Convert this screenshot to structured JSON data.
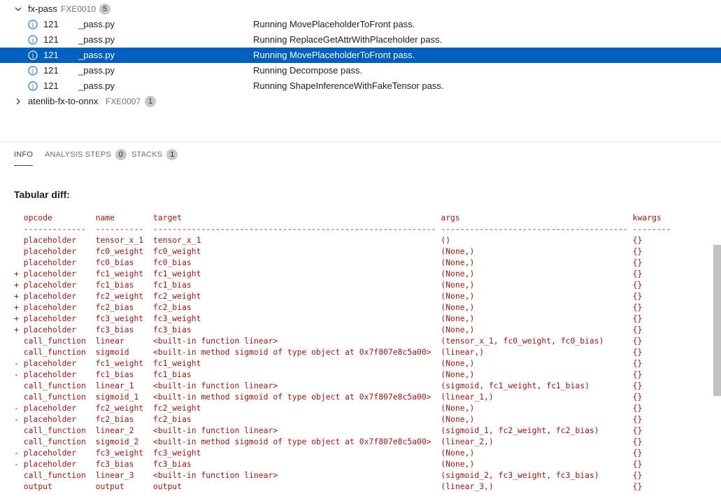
{
  "rules": [
    {
      "name": "fx-pass",
      "id": "FXE0010",
      "count": "5",
      "expanded": true
    },
    {
      "name": "atenlib-fx-to-onnx",
      "id": "FXE0007",
      "count": "1",
      "expanded": false
    }
  ],
  "results": [
    {
      "line": "121",
      "file": "_pass.py",
      "message": "Running MovePlaceholderToFront pass.",
      "selected": false
    },
    {
      "line": "121",
      "file": "_pass.py",
      "message": "Running ReplaceGetAttrWithPlaceholder pass.",
      "selected": false
    },
    {
      "line": "121",
      "file": "_pass.py",
      "message": "Running MovePlaceholderToFront pass.",
      "selected": true
    },
    {
      "line": "121",
      "file": "_pass.py",
      "message": "Running Decompose pass.",
      "selected": false
    },
    {
      "line": "121",
      "file": "_pass.py",
      "message": "Running ShapeInferenceWithFakeTensor pass.",
      "selected": false
    }
  ],
  "tabs": [
    {
      "label": "INFO",
      "count": ""
    },
    {
      "label": "ANALYSIS STEPS",
      "count": "0"
    },
    {
      "label": "STACKS",
      "count": "1"
    }
  ],
  "active_tab": "INFO",
  "heading": "Tabular diff:",
  "diff_header": [
    "opcode",
    "name",
    "target",
    "args",
    "kwargs"
  ],
  "diff_separator": [
    "-------------",
    "----------",
    "-----------------------------------------------------------",
    "---------------------------------------",
    "--------"
  ],
  "diff_rows": [
    [
      " ",
      "placeholder",
      "tensor_x_1",
      "tensor_x_1",
      "()",
      "{}"
    ],
    [
      " ",
      "placeholder",
      "fc0_weight",
      "fc0_weight",
      "(None,)",
      "{}"
    ],
    [
      " ",
      "placeholder",
      "fc0_bias",
      "fc0_bias",
      "(None,)",
      "{}"
    ],
    [
      "+",
      "placeholder",
      "fc1_weight",
      "fc1_weight",
      "(None,)",
      "{}"
    ],
    [
      "+",
      "placeholder",
      "fc1_bias",
      "fc1_bias",
      "(None,)",
      "{}"
    ],
    [
      "+",
      "placeholder",
      "fc2_weight",
      "fc2_weight",
      "(None,)",
      "{}"
    ],
    [
      "+",
      "placeholder",
      "fc2_bias",
      "fc2_bias",
      "(None,)",
      "{}"
    ],
    [
      "+",
      "placeholder",
      "fc3_weight",
      "fc3_weight",
      "(None,)",
      "{}"
    ],
    [
      "+",
      "placeholder",
      "fc3_bias",
      "fc3_bias",
      "(None,)",
      "{}"
    ],
    [
      " ",
      "call_function",
      "linear",
      "<built-in function linear>",
      "(tensor_x_1, fc0_weight, fc0_bias)",
      "{}"
    ],
    [
      " ",
      "call_function",
      "sigmoid",
      "<built-in method sigmoid of type object at 0x7f807e8c5a00>",
      "(linear,)",
      "{}"
    ],
    [
      "-",
      "placeholder",
      "fc1_weight",
      "fc1_weight",
      "(None,)",
      "{}"
    ],
    [
      "-",
      "placeholder",
      "fc1_bias",
      "fc1_bias",
      "(None,)",
      "{}"
    ],
    [
      " ",
      "call_function",
      "linear_1",
      "<built-in function linear>",
      "(sigmoid, fc1_weight, fc1_bias)",
      "{}"
    ],
    [
      " ",
      "call_function",
      "sigmoid_1",
      "<built-in method sigmoid of type object at 0x7f807e8c5a00>",
      "(linear_1,)",
      "{}"
    ],
    [
      "-",
      "placeholder",
      "fc2_weight",
      "fc2_weight",
      "(None,)",
      "{}"
    ],
    [
      "-",
      "placeholder",
      "fc2_bias",
      "fc2_bias",
      "(None,)",
      "{}"
    ],
    [
      " ",
      "call_function",
      "linear_2",
      "<built-in function linear>",
      "(sigmoid_1, fc2_weight, fc2_bias)",
      "{}"
    ],
    [
      " ",
      "call_function",
      "sigmoid_2",
      "<built-in method sigmoid of type object at 0x7f807e8c5a00>",
      "(linear_2,)",
      "{}"
    ],
    [
      "-",
      "placeholder",
      "fc3_weight",
      "fc3_weight",
      "(None,)",
      "{}"
    ],
    [
      "-",
      "placeholder",
      "fc3_bias",
      "fc3_bias",
      "(None,)",
      "{}"
    ],
    [
      " ",
      "call_function",
      "linear_3",
      "<built-in function linear>",
      "(sigmoid_2, fc3_weight, fc3_bias)",
      "{}"
    ],
    [
      " ",
      "output",
      "output",
      "output",
      "(linear_3,)",
      "{}"
    ]
  ],
  "colors": {
    "selection": "#0060c0",
    "info_icon": "#1a73d9",
    "diff_text": "#a31515"
  }
}
